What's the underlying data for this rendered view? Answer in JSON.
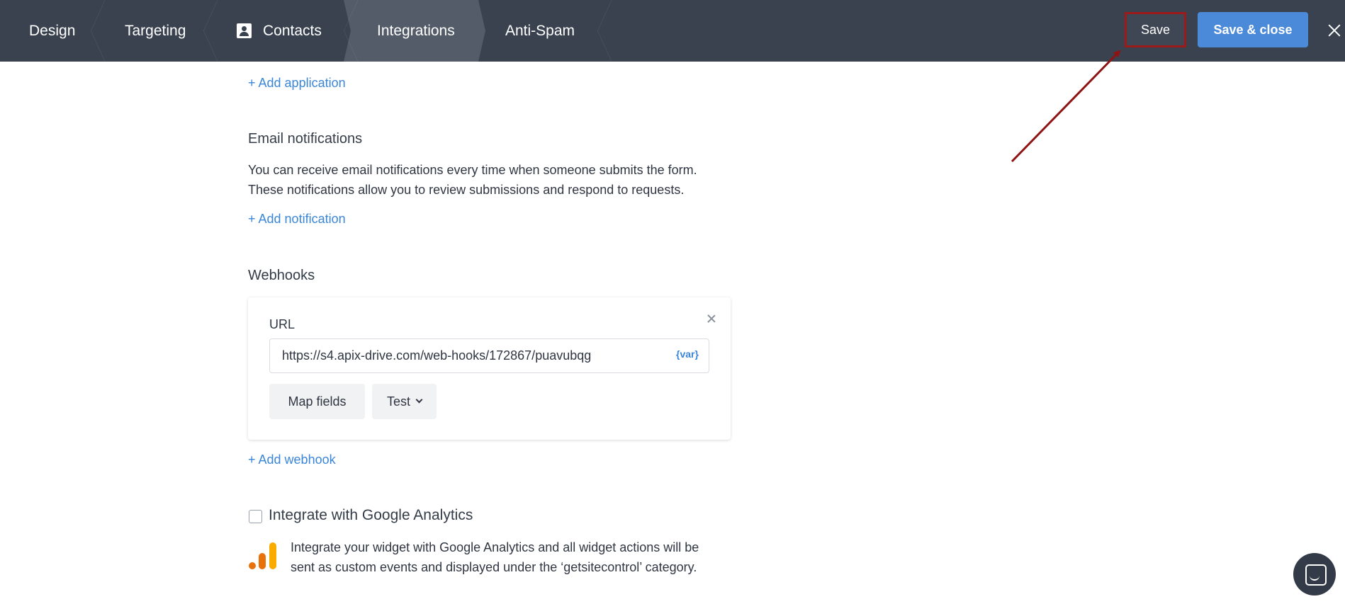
{
  "nav": {
    "tabs": [
      {
        "label": "Design"
      },
      {
        "label": "Targeting"
      },
      {
        "label": "Contacts"
      },
      {
        "label": "Integrations",
        "active": true
      },
      {
        "label": "Anti-Spam"
      }
    ],
    "save_label": "Save",
    "save_close_label": "Save & close"
  },
  "content": {
    "add_application_label": "+ Add application",
    "email": {
      "title": "Email notifications",
      "description_line1": "You can receive email notifications every time when someone submits the form.",
      "description_line2": "These notifications allow you to review submissions and respond to requests.",
      "add_label": "+ Add notification"
    },
    "webhooks": {
      "title": "Webhooks",
      "url_label": "URL",
      "url_value": "https://s4.apix-drive.com/web-hooks/172867/puavubqg",
      "var_label": "{var}",
      "map_fields_label": "Map fields",
      "test_label": "Test",
      "add_label": "+ Add webhook"
    },
    "google_analytics": {
      "checkbox_label": "Integrate with Google Analytics",
      "checked": false,
      "description_line1": "Integrate your widget with Google Analytics and all widget actions will be",
      "description_line2": "sent as custom events and displayed under the ‘getsitecontrol’ category."
    }
  },
  "colors": {
    "topbar": "#3a4250",
    "accent": "#4a8ad9",
    "link": "#3a86d8",
    "highlight": "#9b1b1b"
  }
}
